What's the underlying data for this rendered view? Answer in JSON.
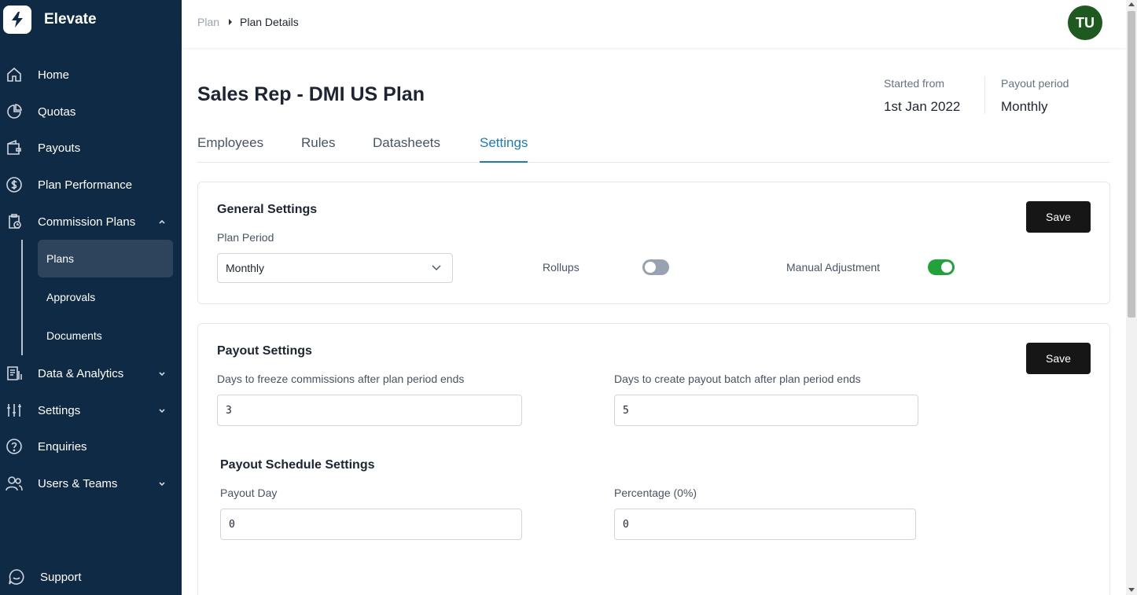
{
  "app": {
    "name": "Elevate"
  },
  "sidebar": {
    "items": [
      {
        "label": "Home",
        "icon": "home-icon"
      },
      {
        "label": "Quotas",
        "icon": "pie-chart-icon"
      },
      {
        "label": "Payouts",
        "icon": "wallet-icon"
      },
      {
        "label": "Plan Performance",
        "icon": "dollar-circle-icon"
      },
      {
        "label": "Commission Plans",
        "icon": "clipboard-icon",
        "expanded": true
      },
      {
        "label": "Data & Analytics",
        "icon": "document-chart-icon"
      },
      {
        "label": "Settings",
        "icon": "sliders-icon"
      },
      {
        "label": "Enquiries",
        "icon": "help-circle-icon"
      },
      {
        "label": "Users & Teams",
        "icon": "users-icon"
      }
    ],
    "subitems": [
      {
        "label": "Plans",
        "active": true
      },
      {
        "label": "Approvals"
      },
      {
        "label": "Documents"
      }
    ],
    "support": {
      "label": "Support",
      "icon": "chat-icon"
    }
  },
  "topbar": {
    "breadcrumb": [
      "Plan",
      "Plan Details"
    ],
    "avatar_initials": "TU"
  },
  "plan": {
    "title": "Sales Rep - DMI US Plan",
    "started_label": "Started from",
    "started_value": "1st Jan 2022",
    "payout_label": "Payout period",
    "payout_value": "Monthly"
  },
  "tabs": [
    {
      "label": "Employees"
    },
    {
      "label": "Rules"
    },
    {
      "label": "Datasheets"
    },
    {
      "label": "Settings",
      "active": true
    }
  ],
  "general": {
    "title": "General Settings",
    "save_label": "Save",
    "plan_period_label": "Plan Period",
    "plan_period_value": "Monthly",
    "rollups_label": "Rollups",
    "rollups_enabled": false,
    "manual_adjustment_label": "Manual Adjustment",
    "manual_adjustment_enabled": true
  },
  "payout": {
    "title": "Payout Settings",
    "save_label": "Save",
    "freeze_label": "Days to freeze commissions after plan period ends",
    "freeze_value": "3",
    "batch_label": "Days to create payout batch after plan period ends",
    "batch_value": "5",
    "schedule_title": "Payout Schedule Settings",
    "payout_day_label": "Payout Day",
    "payout_day_value": "0",
    "percentage_label": "Percentage (0%)",
    "percentage_value": "0"
  },
  "colors": {
    "sidebar_bg": "#0f2a44",
    "active_tab": "#1a7bc0",
    "toggle_on": "#22a33a",
    "avatar_bg": "#1e5a20"
  }
}
